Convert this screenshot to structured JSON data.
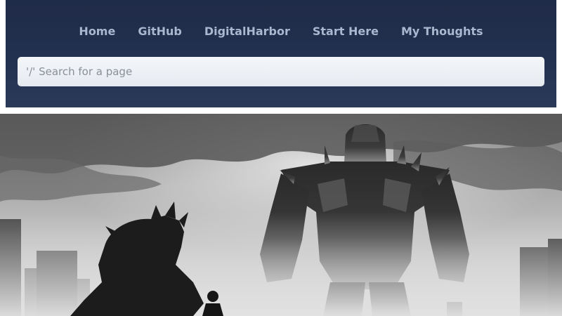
{
  "nav": {
    "items": [
      {
        "label": "Home"
      },
      {
        "label": "GitHub"
      },
      {
        "label": "DigitalHarbor"
      },
      {
        "label": "Start Here"
      },
      {
        "label": "My Thoughts"
      }
    ]
  },
  "search": {
    "placeholder": "'/' Search for a page"
  },
  "hero": {
    "icon": "hero-banner-image"
  },
  "colors": {
    "header_bg": "#223150",
    "nav_text": "#aab8cf",
    "search_bg": "#eef1f5"
  }
}
